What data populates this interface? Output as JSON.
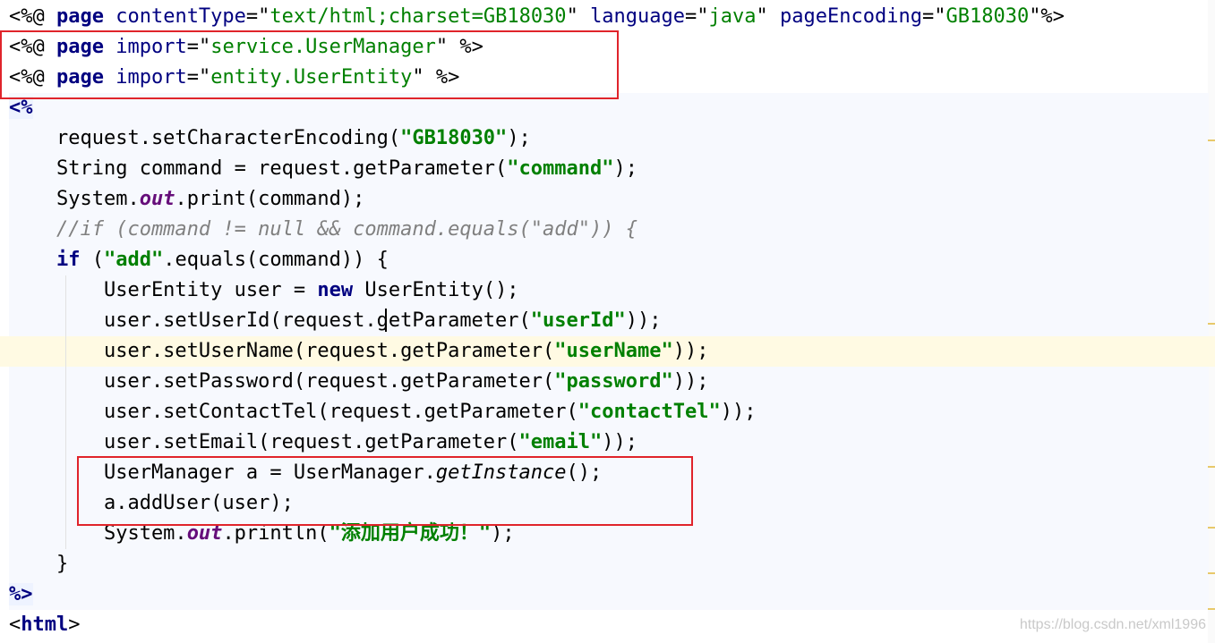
{
  "editor": {
    "lines": [
      {
        "segments": [
          {
            "t": "<%@ ",
            "c": "delim"
          },
          {
            "t": "page",
            "c": "kw"
          },
          {
            "t": " ",
            "c": ""
          },
          {
            "t": "contentType",
            "c": "kw2"
          },
          {
            "t": "=\"",
            "c": ""
          },
          {
            "t": "text/html;charset=GB18030",
            "c": "attrval"
          },
          {
            "t": "\" ",
            "c": ""
          },
          {
            "t": "language",
            "c": "kw2"
          },
          {
            "t": "=\"",
            "c": ""
          },
          {
            "t": "java",
            "c": "attrval"
          },
          {
            "t": "\" ",
            "c": ""
          },
          {
            "t": "pageEncoding",
            "c": "kw2"
          },
          {
            "t": "=\"",
            "c": ""
          },
          {
            "t": "GB18030",
            "c": "attrval"
          },
          {
            "t": "\"%>",
            "c": ""
          }
        ]
      },
      {
        "segments": [
          {
            "t": "<%@ ",
            "c": "delim"
          },
          {
            "t": "page",
            "c": "kw"
          },
          {
            "t": " ",
            "c": ""
          },
          {
            "t": "import",
            "c": "kw2"
          },
          {
            "t": "=\"",
            "c": ""
          },
          {
            "t": "service.UserManager",
            "c": "attrval"
          },
          {
            "t": "\" %>",
            "c": ""
          }
        ]
      },
      {
        "segments": [
          {
            "t": "<%@ ",
            "c": "delim"
          },
          {
            "t": "page",
            "c": "kw"
          },
          {
            "t": " ",
            "c": ""
          },
          {
            "t": "import",
            "c": "kw2"
          },
          {
            "t": "=\"",
            "c": ""
          },
          {
            "t": "entity.UserEntity",
            "c": "attrval"
          },
          {
            "t": "\" %>",
            "c": ""
          }
        ]
      },
      {
        "segments": [
          {
            "t": "<%",
            "c": "scriptlet"
          }
        ]
      },
      {
        "segments": [
          {
            "t": "    request.setCharacterEncoding(",
            "c": ""
          },
          {
            "t": "\"GB18030\"",
            "c": "str"
          },
          {
            "t": ");",
            "c": ""
          }
        ]
      },
      {
        "segments": [
          {
            "t": "    String command = request.getParameter(",
            "c": ""
          },
          {
            "t": "\"command\"",
            "c": "str"
          },
          {
            "t": ");",
            "c": ""
          }
        ]
      },
      {
        "segments": [
          {
            "t": "    System.",
            "c": ""
          },
          {
            "t": "out",
            "c": "field"
          },
          {
            "t": ".print(command);",
            "c": ""
          }
        ]
      },
      {
        "segments": [
          {
            "t": "    //if (command != null && command.equals(\"add\")) {",
            "c": "comment"
          }
        ]
      },
      {
        "segments": [
          {
            "t": "    ",
            "c": ""
          },
          {
            "t": "if",
            "c": "kw"
          },
          {
            "t": " (",
            "c": ""
          },
          {
            "t": "\"add\"",
            "c": "str"
          },
          {
            "t": ".equals(command)) {",
            "c": ""
          }
        ]
      },
      {
        "segments": [
          {
            "t": "        UserEntity user = ",
            "c": ""
          },
          {
            "t": "new",
            "c": "kw"
          },
          {
            "t": " UserEntity();",
            "c": ""
          }
        ]
      },
      {
        "segments": [
          {
            "t": "        user.setUserId(request.getParameter(",
            "c": ""
          },
          {
            "t": "\"userId\"",
            "c": "str"
          },
          {
            "t": "));",
            "c": ""
          }
        ]
      },
      {
        "segments": [
          {
            "t": "        user.setUserName(request.getParameter(",
            "c": ""
          },
          {
            "t": "\"userName\"",
            "c": "str"
          },
          {
            "t": "));",
            "c": ""
          }
        ]
      },
      {
        "segments": [
          {
            "t": "        user.setPassword(request.getParameter(",
            "c": ""
          },
          {
            "t": "\"password\"",
            "c": "str"
          },
          {
            "t": "));",
            "c": ""
          }
        ]
      },
      {
        "segments": [
          {
            "t": "        user.setContactTel(request.getParameter(",
            "c": ""
          },
          {
            "t": "\"contactTel\"",
            "c": "str"
          },
          {
            "t": "));",
            "c": ""
          }
        ]
      },
      {
        "segments": [
          {
            "t": "        user.setEmail(request.getParameter(",
            "c": ""
          },
          {
            "t": "\"email\"",
            "c": "str"
          },
          {
            "t": "));",
            "c": ""
          }
        ]
      },
      {
        "segments": [
          {
            "t": "        UserManager a = UserManager.",
            "c": ""
          },
          {
            "t": "getInstance",
            "c": "static-call"
          },
          {
            "t": "();",
            "c": ""
          }
        ]
      },
      {
        "segments": [
          {
            "t": "        a.addUser(user);",
            "c": ""
          }
        ]
      },
      {
        "segments": [
          {
            "t": "        System.",
            "c": ""
          },
          {
            "t": "out",
            "c": "field"
          },
          {
            "t": ".println(",
            "c": ""
          },
          {
            "t": "\"添加用户成功！\"",
            "c": "str"
          },
          {
            "t": ");",
            "c": ""
          }
        ]
      },
      {
        "segments": [
          {
            "t": "    }",
            "c": ""
          }
        ]
      },
      {
        "segments": [
          {
            "t": "%>",
            "c": "scriptlet"
          }
        ]
      },
      {
        "segments": [
          {
            "t": "<",
            "c": ""
          },
          {
            "t": "html",
            "c": "tag"
          },
          {
            "t": ">",
            "c": ""
          }
        ]
      }
    ],
    "current_line": 11,
    "highlighted_lines": [
      [
        2,
        3
      ],
      [
        16,
        17
      ]
    ]
  },
  "watermark": "https://blog.csdn.net/xml1996",
  "colors": {
    "highlight_box": "#e0242b",
    "current_line": "#fffae3",
    "keyword": "#000080",
    "string": "#008000"
  }
}
